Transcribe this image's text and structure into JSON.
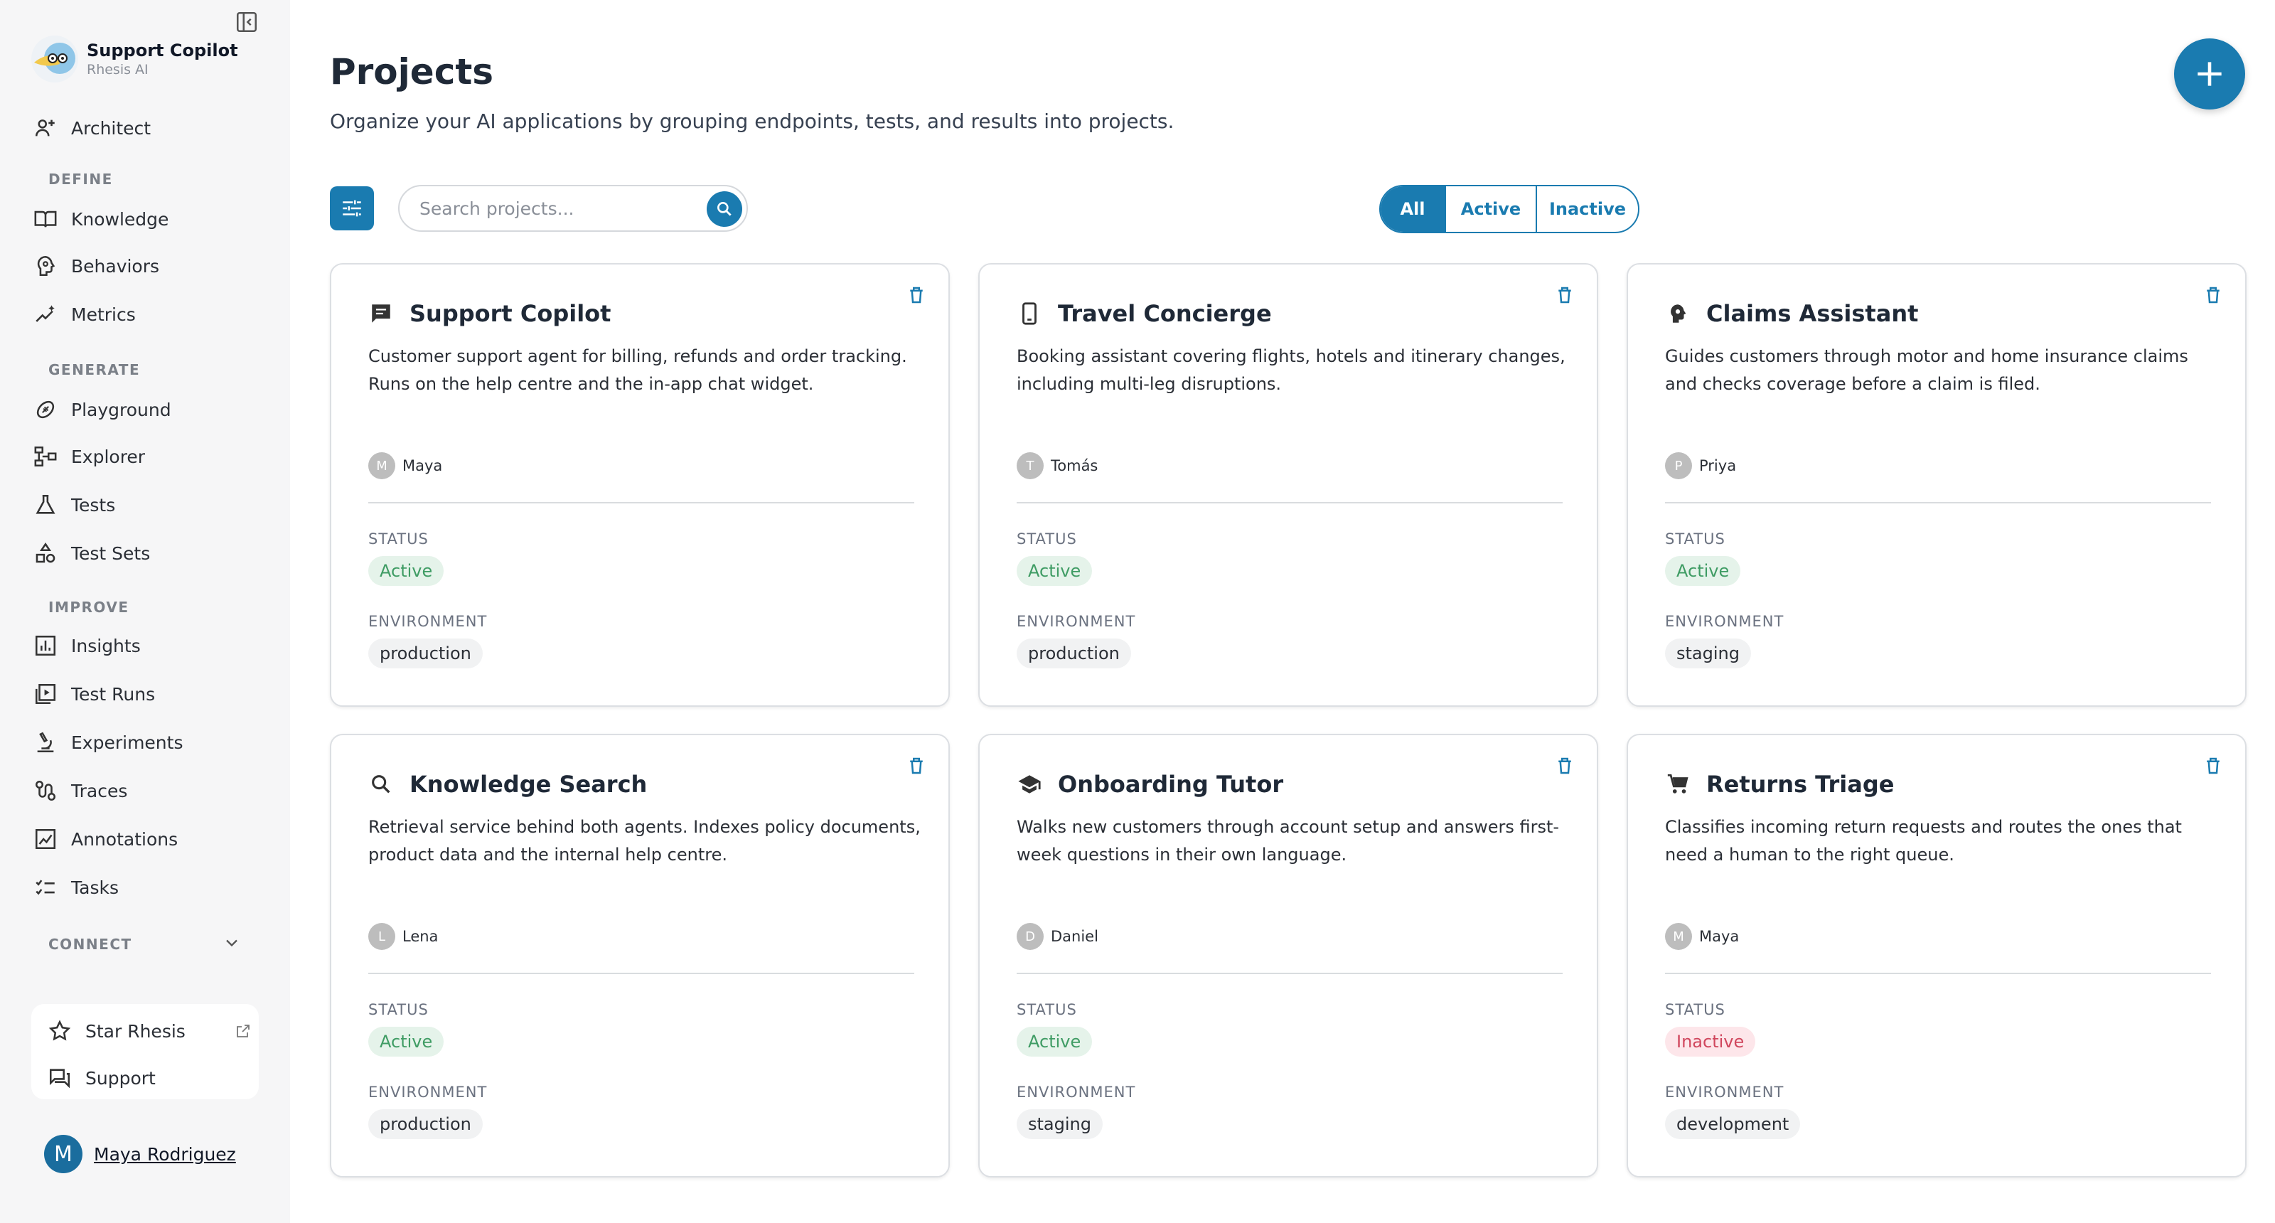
{
  "sidebar": {
    "app_title": "Support Copilot",
    "app_subtitle": "Rhesis AI",
    "architect": "Architect",
    "sections": {
      "define": "DEFINE",
      "generate": "GENERATE",
      "improve": "IMPROVE",
      "connect": "CONNECT"
    },
    "items": {
      "knowledge": "Knowledge",
      "behaviors": "Behaviors",
      "metrics": "Metrics",
      "playground": "Playground",
      "explorer": "Explorer",
      "tests": "Tests",
      "test_sets": "Test Sets",
      "insights": "Insights",
      "test_runs": "Test Runs",
      "experiments": "Experiments",
      "traces": "Traces",
      "annotations": "Annotations",
      "tasks": "Tasks"
    },
    "star": "Star Rhesis",
    "support": "Support",
    "user_initial": "M",
    "user_name": "Maya Rodriguez"
  },
  "header": {
    "title": "Projects",
    "subtitle": "Organize your AI applications by grouping endpoints, tests, and results into projects."
  },
  "search": {
    "placeholder": "Search projects..."
  },
  "filter": {
    "all": "All",
    "active": "Active",
    "inactive": "Inactive",
    "selected": "All"
  },
  "labels": {
    "status": "STATUS",
    "environment": "ENVIRONMENT"
  },
  "colors": {
    "accent": "#1a7bb0",
    "active": "#3f9c64",
    "inactive": "#d0465d"
  },
  "projects": [
    {
      "name": "Support Copilot",
      "icon": "chat-icon",
      "description": "Customer support agent for billing, refunds and order tracking. Runs on the help centre and the in-app chat widget.",
      "owner_initial": "M",
      "owner": "Maya",
      "status": "Active",
      "environment": "production"
    },
    {
      "name": "Travel Concierge",
      "icon": "smartphone-icon",
      "description": "Booking assistant covering flights, hotels and itinerary changes, including multi-leg disruptions.",
      "owner_initial": "T",
      "owner": "Tomás",
      "status": "Active",
      "environment": "production"
    },
    {
      "name": "Claims Assistant",
      "icon": "psychology-icon",
      "description": "Guides customers through motor and home insurance claims and checks coverage before a claim is filed.",
      "owner_initial": "P",
      "owner": "Priya",
      "status": "Active",
      "environment": "staging"
    },
    {
      "name": "Knowledge Search",
      "icon": "search-icon",
      "description": "Retrieval service behind both agents. Indexes policy documents, product data and the internal help centre.",
      "owner_initial": "L",
      "owner": "Lena",
      "status": "Active",
      "environment": "production"
    },
    {
      "name": "Onboarding Tutor",
      "icon": "school-icon",
      "description": "Walks new customers through account setup and answers first-week questions in their own language.",
      "owner_initial": "D",
      "owner": "Daniel",
      "status": "Active",
      "environment": "staging"
    },
    {
      "name": "Returns Triage",
      "icon": "cart-icon",
      "description": "Classifies incoming return requests and routes the ones that need a human to the right queue.",
      "owner_initial": "M",
      "owner": "Maya",
      "status": "Inactive",
      "environment": "development"
    }
  ]
}
